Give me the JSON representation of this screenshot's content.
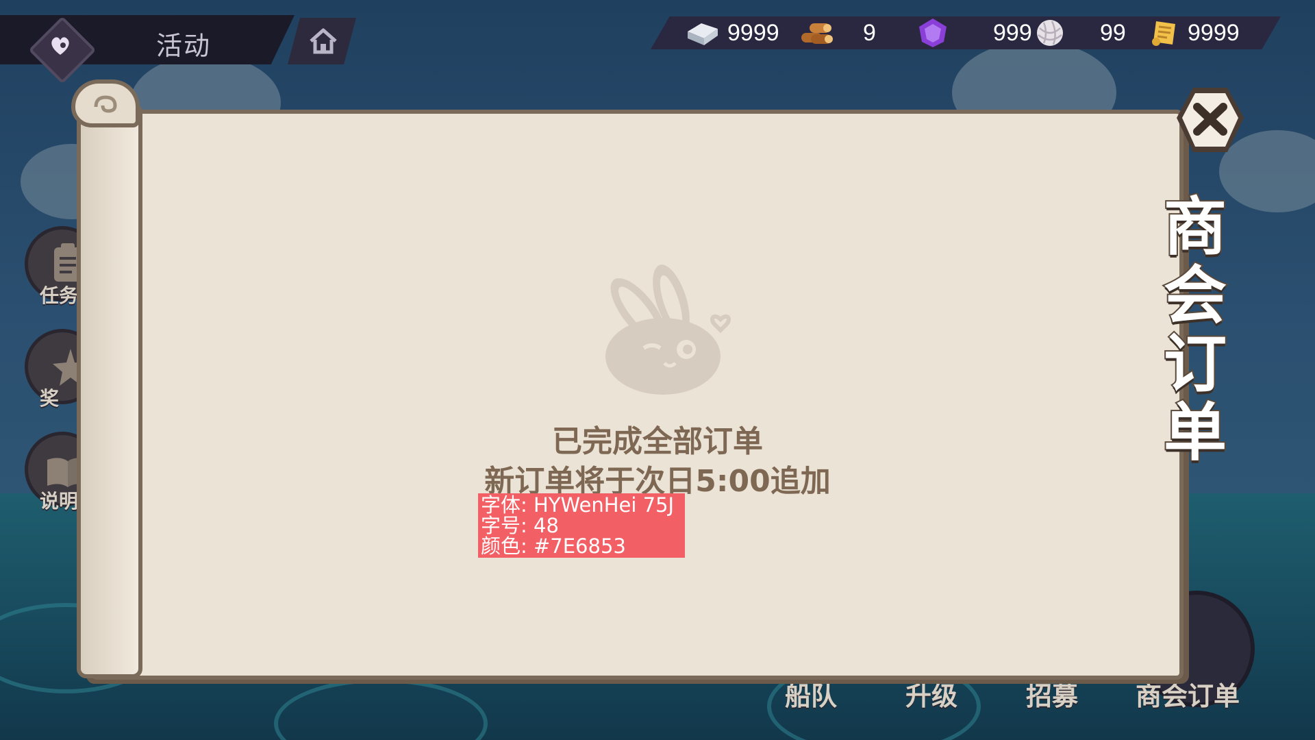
{
  "header": {
    "title": "活动"
  },
  "resources": [
    {
      "icon": "silver-ingot-icon",
      "value": "9999"
    },
    {
      "icon": "wood-logs-icon",
      "value": "9"
    },
    {
      "icon": "purple-gem-icon",
      "value": "999"
    },
    {
      "icon": "yarn-ball-icon",
      "value": "99"
    },
    {
      "icon": "scroll-ticket-icon",
      "value": "9999"
    }
  ],
  "side_menu": [
    {
      "label": "任务"
    },
    {
      "label": "奖"
    },
    {
      "label": "说明"
    }
  ],
  "panel": {
    "vertical_title": [
      "商",
      "会",
      "订",
      "单"
    ],
    "empty_line1": "已完成全部订单",
    "empty_line2": "新订单将于次日5:00追加"
  },
  "annotation": {
    "line1": "字体: HYWenHei 75J",
    "line2": "字号: 48",
    "line3": "颜色: #7E6853"
  },
  "bottom_nav": [
    {
      "label": "船队"
    },
    {
      "label": "升级"
    },
    {
      "label": "招募"
    },
    {
      "label": "商会订单"
    }
  ],
  "colors": {
    "empty_text": "#7E6853",
    "annotation_bg": "#F26065"
  }
}
